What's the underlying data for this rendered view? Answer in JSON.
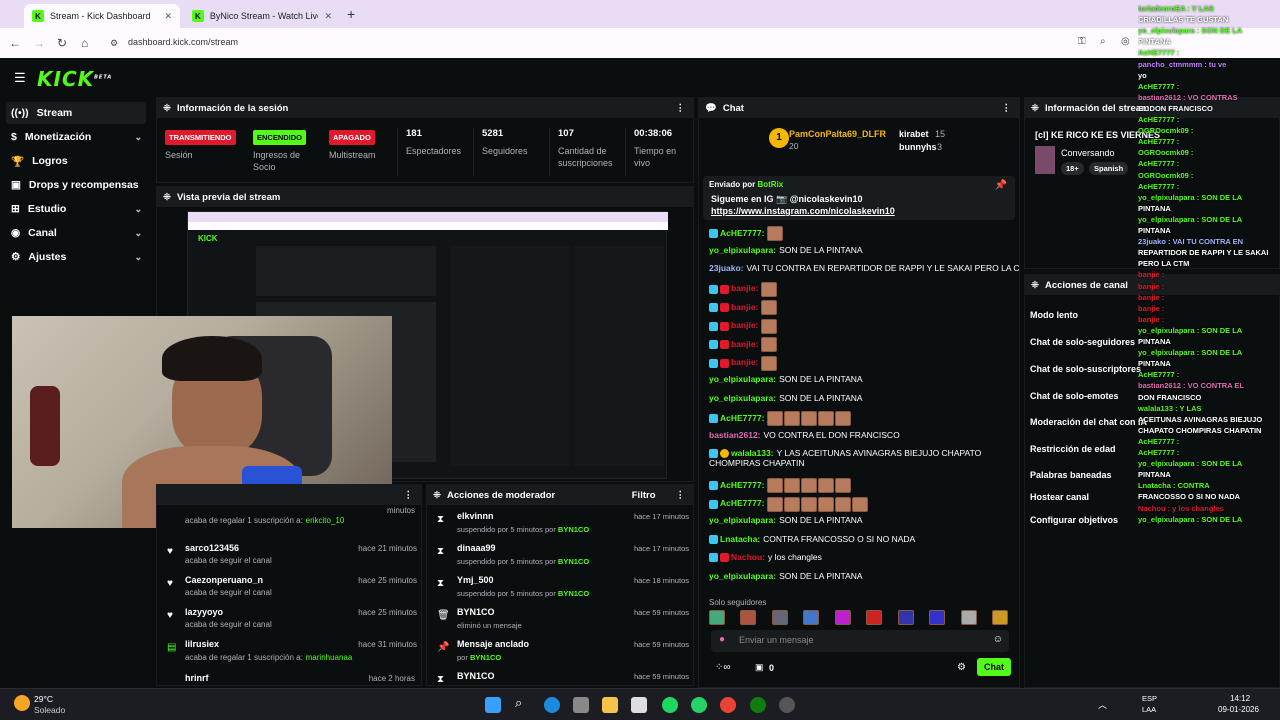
{
  "browser": {
    "tabs": [
      {
        "label": "Stream - Kick Dashboard"
      },
      {
        "label": "ByNico Stream - Watch Live on"
      }
    ],
    "new_tab": "+",
    "url": "dashboard.kick.com/stream"
  },
  "app": {
    "logo": "KICK",
    "logo_sup": "BETA"
  },
  "sidebar": {
    "items": [
      {
        "label": "Stream",
        "icon": "broadcast-icon"
      },
      {
        "label": "Monetización",
        "icon": "dollar-icon"
      },
      {
        "label": "Logros",
        "icon": "trophy-icon"
      },
      {
        "label": "Drops y recompensas",
        "icon": "gift-icon"
      },
      {
        "label": "Estudio",
        "icon": "grid-icon"
      },
      {
        "label": "Canal",
        "icon": "user-icon"
      },
      {
        "label": "Ajustes",
        "icon": "gear-icon"
      }
    ]
  },
  "session": {
    "title": "Información de la sesión",
    "stats": [
      {
        "badge": "TRANSMITIENDO",
        "label": "Sesión",
        "color": "#e0192c"
      },
      {
        "badge": "ENCENDIDO",
        "label": "Ingresos de Socio",
        "color": "#53fc18"
      },
      {
        "badge": "APAGADO",
        "label": "Multistream",
        "color": "#e0192c"
      },
      {
        "value": "181",
        "label": "Espectadores"
      },
      {
        "value": "5281",
        "label": "Seguidores"
      },
      {
        "value": "107",
        "label": "Cantidad de suscripciones"
      },
      {
        "value": "00:38:06",
        "label": "Tiempo en vivo"
      }
    ]
  },
  "preview": {
    "title": "Vista previa del stream"
  },
  "activity": {
    "items": [
      {
        "user": "",
        "action": "acaba de regalar 1 suscripción a:",
        "target": "erikcito_10",
        "time": "minutos"
      },
      {
        "user": "sarco123456",
        "action": "acaba de seguir el canal",
        "time": "hace 21 minutos"
      },
      {
        "user": "Caezonperuano_n",
        "action": "acaba de seguir el canal",
        "time": "hace 25 minutos"
      },
      {
        "user": "lazyyoyo",
        "action": "acaba de seguir el canal",
        "time": "hace 25 minutos"
      },
      {
        "user": "lilrusiex",
        "action": "acaba de regalar 1 suscripción a:",
        "target": "marinhuanaa",
        "time": "hace 31 minutos"
      },
      {
        "user": "hrinrf",
        "time": "hace 2 horas"
      }
    ]
  },
  "mod": {
    "title": "Acciones de moderador",
    "filter": "Filtro",
    "items": [
      {
        "user": "elkvinnn",
        "desc": "suspendido por 5 minutos por",
        "by": "BYN1CO",
        "time": "hace 17 minutos"
      },
      {
        "user": "dinaaa99",
        "desc": "suspendido por 5 minutos por",
        "by": "BYN1CO",
        "time": "hace 17 minutos"
      },
      {
        "user": "Ymj_500",
        "desc": "suspendido por 5 minutos por",
        "by": "BYN1CO",
        "time": "hace 18 minutos"
      },
      {
        "user": "BYN1CO",
        "desc": "eliminó un mensaje",
        "by": "",
        "time": "hace 59 minutos"
      },
      {
        "user": "Mensaje anclado",
        "desc": "por",
        "by": "BYN1CO",
        "time": "hace 59 minutos"
      },
      {
        "user": "BYN1CO",
        "desc": "",
        "by": "",
        "time": "hace 59 minutos"
      }
    ]
  },
  "chat": {
    "title": "Chat",
    "top": [
      {
        "user": "PamConPalta69_DLFR",
        "count": "20"
      },
      {
        "user": "kirabet",
        "count": "15"
      },
      {
        "user": "bunnyhs",
        "count": "3"
      }
    ],
    "pinned": {
      "label": "Enviado por",
      "by": "BotRix",
      "line1": "Siguеme en IG 📷 @nicolaskevin10",
      "link": "https://www.instagram.com/nicolaskevin10"
    },
    "messages": [
      {
        "user": "AcHE7777:",
        "text": "",
        "emotes": 1,
        "color": "#53fc18"
      },
      {
        "user": "yo_elpixulapara:",
        "text": "SON DE LA PINTANA",
        "color": "#53fc18"
      },
      {
        "user": "23juako:",
        "text": "VAI TU CONTRA EN REPARTIDOR DE RAPPI Y LE SAKAI PERO LA CTM",
        "color": "#9fb4ff"
      },
      {
        "user": "banjie:",
        "text": "",
        "emotes": 1,
        "color": "#e0192c"
      },
      {
        "user": "banjie:",
        "text": "",
        "emotes": 1,
        "color": "#e0192c"
      },
      {
        "user": "banjie:",
        "text": "",
        "emotes": 1,
        "color": "#e0192c"
      },
      {
        "user": "banjie:",
        "text": "",
        "emotes": 1,
        "color": "#e0192c"
      },
      {
        "user": "banjie:",
        "text": "",
        "emotes": 1,
        "color": "#e0192c"
      },
      {
        "user": "yo_elpixulapara:",
        "text": "SON DE LA PINTANA",
        "color": "#53fc18"
      },
      {
        "user": "yo_elpixulapara:",
        "text": "SON DE LA PINTANA",
        "color": "#53fc18"
      },
      {
        "user": "AcHE7777:",
        "text": "",
        "emotes": 5,
        "color": "#53fc18"
      },
      {
        "user": "bastian2612:",
        "text": "VO CONTRA EL DON FRANCISCO",
        "color": "#e06bb4"
      },
      {
        "user": "walala133:",
        "text": "Y LAS ACEITUNAS AVINAGRAS BIEJUJO CHAPATO",
        "text2": "CHOMPIRAS CHAPATIN",
        "color": "#53fc18"
      },
      {
        "user": "AcHE7777:",
        "text": "",
        "emotes": 5,
        "color": "#53fc18"
      },
      {
        "user": "AcHE7777:",
        "text": "",
        "emotes": 6,
        "color": "#53fc18"
      },
      {
        "user": "yo_elpixulapara:",
        "text": "SON DE LA PINTANA",
        "color": "#53fc18"
      },
      {
        "user": "Lnatacha:",
        "text": "CONTRA FRANCOSSO O SI NO NADA",
        "color": "#53fc18"
      },
      {
        "user": "Nachou:",
        "text": "y los changles",
        "color": "#e0192c"
      },
      {
        "user": "yo_elpixulapara:",
        "text": "SON DE LA PINTANA",
        "color": "#53fc18"
      }
    ],
    "followers_only": "Solo seguidores",
    "placeholder": "Enviar un mensaje",
    "points": "0",
    "send": "Chat"
  },
  "stream_info": {
    "title": "Información del stream",
    "stream_title": "[cl] KE RICO KE ES VIERNES",
    "category": "Conversando",
    "tags": [
      "18+",
      "Spanish"
    ]
  },
  "channel_actions": {
    "title": "Acciones de canal",
    "items": [
      "Modo lento",
      "Chat de solo-seguidores",
      "Chat de solo-suscriptores",
      "Chat de solo-emotes",
      "Moderación del chat con IA",
      "Restricción de edad",
      "Palabras baneadas",
      "Hostear canal",
      "Configurar objetivos"
    ]
  },
  "overlay": {
    "lines": [
      {
        "text": "turiadeoroEA : Y LAS",
        "c": "#53fc18"
      },
      {
        "text": "CRIADILLAS TE GUSTAN",
        "c": "#fff"
      },
      {
        "text": "yo_elpixulapara : SON DE LA",
        "c": "#53fc18"
      },
      {
        "text": "PINTANA",
        "c": "#fff"
      },
      {
        "text": "AcHE7777 :",
        "c": "#53fc18"
      },
      {
        "text": "pancho_ctmmmm : tu ve",
        "c": "#c77dff"
      },
      {
        "text": "yo",
        "c": "#fff"
      },
      {
        "text": "AcHE7777 :",
        "c": "#53fc18"
      },
      {
        "text": "bastian2612 : VO CONTRAS",
        "c": "#e06bb4"
      },
      {
        "text": "EL DON FRANCISCO",
        "c": "#fff"
      },
      {
        "text": "AcHE7777 :",
        "c": "#53fc18"
      },
      {
        "text": "OGROocmk09 :",
        "c": "#53fc18"
      },
      {
        "text": "AcHE7777 :",
        "c": "#53fc18"
      },
      {
        "text": "OGROocmk09 :",
        "c": "#53fc18"
      },
      {
        "text": "AcHE7777 :",
        "c": "#53fc18"
      },
      {
        "text": "OGROocmk09 :",
        "c": "#53fc18"
      },
      {
        "text": "AcHE7777 :",
        "c": "#53fc18"
      },
      {
        "text": "yo_elpixulapara : SON DE LA",
        "c": "#53fc18"
      },
      {
        "text": "PINTANA",
        "c": "#fff"
      },
      {
        "text": "yo_elpixulapara : SON DE LA",
        "c": "#53fc18"
      },
      {
        "text": "PINTANA",
        "c": "#fff"
      },
      {
        "text": "23juako : VAI TU CONTRA EN",
        "c": "#9fb4ff"
      },
      {
        "text": "REPARTIDOR DE RAPPI Y LE SAKAI",
        "c": "#fff"
      },
      {
        "text": "PERO LA CTM",
        "c": "#fff"
      },
      {
        "text": "banjie :",
        "c": "#e0192c"
      },
      {
        "text": "banjie :",
        "c": "#e0192c"
      },
      {
        "text": "banjie :",
        "c": "#e0192c"
      },
      {
        "text": "banjie :",
        "c": "#e0192c"
      },
      {
        "text": "banjie :",
        "c": "#e0192c"
      },
      {
        "text": "yo_elpixulapara : SON DE LA",
        "c": "#53fc18"
      },
      {
        "text": "PINTANA",
        "c": "#fff"
      },
      {
        "text": "yo_elpixulapara : SON DE LA",
        "c": "#53fc18"
      },
      {
        "text": "PINTANA",
        "c": "#fff"
      },
      {
        "text": "AcHE7777 :",
        "c": "#53fc18"
      },
      {
        "text": "bastian2612 : VO CONTRA EL",
        "c": "#e06bb4"
      },
      {
        "text": "DON FRANCISCO",
        "c": "#fff"
      },
      {
        "text": "walala133 : Y LAS",
        "c": "#53fc18"
      },
      {
        "text": "ACEITUNAS AVINAGRAS BIEJUJO",
        "c": "#fff"
      },
      {
        "text": "CHAPATO CHOMPIRAS CHAPATIN",
        "c": "#fff"
      },
      {
        "text": "AcHE7777 :",
        "c": "#53fc18"
      },
      {
        "text": "AcHE7777 :",
        "c": "#53fc18"
      },
      {
        "text": "yo_elpixulapara : SON DE LA",
        "c": "#53fc18"
      },
      {
        "text": "PINTANA",
        "c": "#fff"
      },
      {
        "text": "Lnatacha : CONTRA",
        "c": "#53fc18"
      },
      {
        "text": "FRANCOSSO O SI NO NADA",
        "c": "#fff"
      },
      {
        "text": "Nachou : y los changles",
        "c": "#e0192c"
      },
      {
        "text": "yo_elpixulapara : SON DE LA",
        "c": "#53fc18"
      }
    ]
  },
  "taskbar": {
    "weather": "29°C",
    "weather_desc": "Soleado",
    "lang": "ESP",
    "lang2": "LAA",
    "time": "14:12",
    "date": "09-01-2026"
  }
}
